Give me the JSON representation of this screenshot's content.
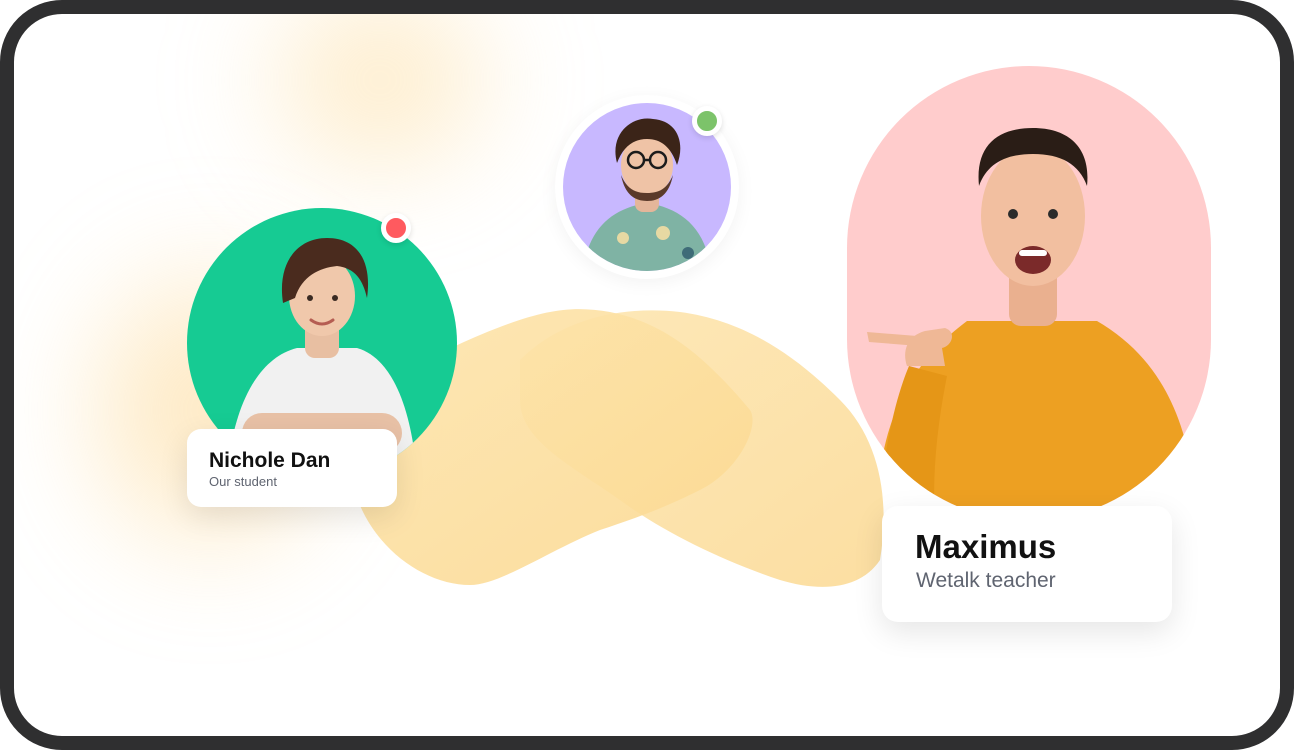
{
  "colors": {
    "frame": "#2f2f30",
    "student_bg": "#16cb93",
    "peer_bg": "#c8b8ff",
    "teacher_bg": "#ffcccc",
    "wave": "#fbd98d",
    "status_offline": "#ff5a5f",
    "status_online": "#7cc36a"
  },
  "student": {
    "name": "Nichole Dan",
    "role": "Our student",
    "status": "offline",
    "avatar_icon": "woman-avatar-icon"
  },
  "peer": {
    "status": "online",
    "avatar_icon": "man-glasses-avatar-icon"
  },
  "teacher": {
    "name": "Maximus",
    "role": "Wetalk teacher",
    "avatar_icon": "man-pointing-avatar-icon"
  }
}
